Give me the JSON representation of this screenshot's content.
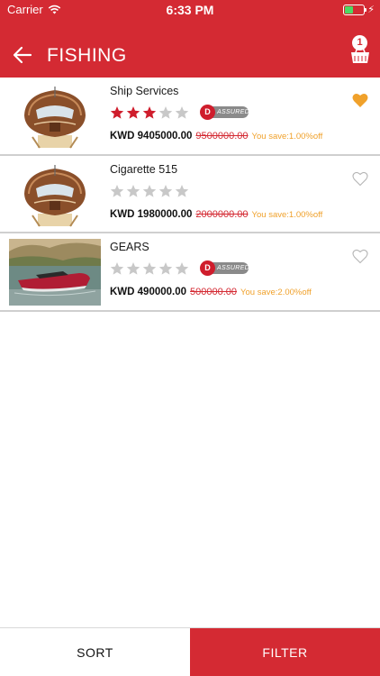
{
  "status_bar": {
    "carrier": "Carrier",
    "time": "6:33 PM"
  },
  "header": {
    "title": "FISHING",
    "cart_count": "1"
  },
  "products": [
    {
      "name": "Ship Services",
      "rating": 3,
      "assured": true,
      "assured_letter": "D",
      "assured_label": "ASSURED",
      "price": "KWD 9405000.00",
      "old_price": "9500000.00",
      "save": "You save:1.00%off",
      "favorited": true,
      "image": "wooden-speedboat"
    },
    {
      "name": "Cigarette 515",
      "rating": 0,
      "assured": false,
      "price": "KWD 1980000.00",
      "old_price": "2000000.00",
      "save": "You save:1.00%off",
      "favorited": false,
      "image": "wooden-speedboat"
    },
    {
      "name": "GEARS",
      "rating": 0,
      "assured": true,
      "assured_letter": "D",
      "assured_label": "ASSURED",
      "price": "KWD 490000.00",
      "old_price": "500000.00",
      "save": "You save:2.00%off",
      "favorited": false,
      "image": "red-speedboat-on-lake"
    }
  ],
  "bottom_bar": {
    "sort": "SORT",
    "filter": "FILTER"
  },
  "colors": {
    "brand": "#d42a33",
    "star_filled": "#cf1d2c",
    "star_empty": "#c8c8c8",
    "favorite": "#f0a12b",
    "save_text": "#f0a12b"
  }
}
